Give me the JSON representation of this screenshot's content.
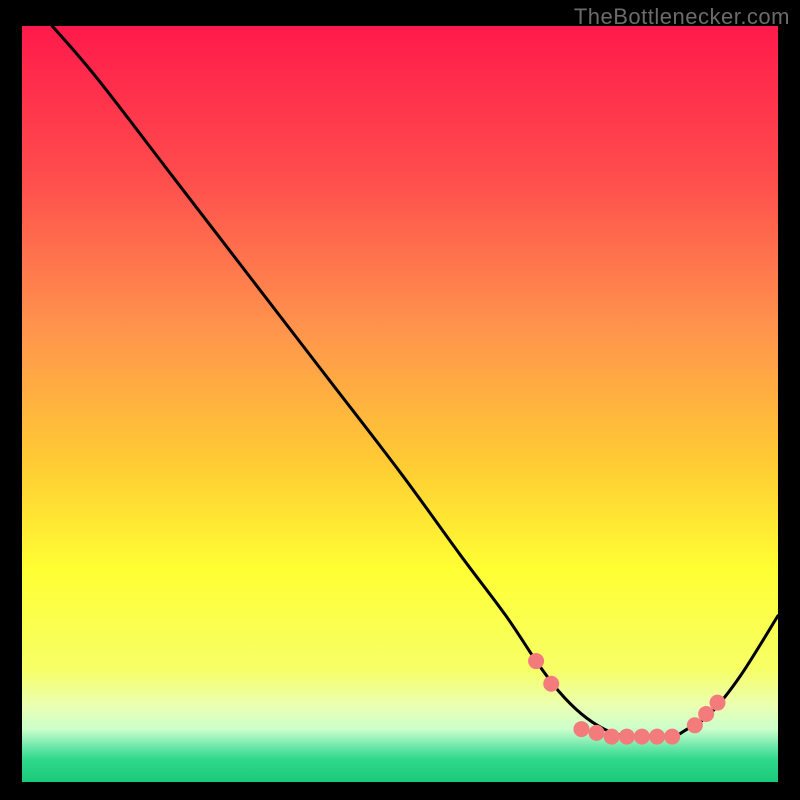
{
  "attribution": "TheBottlenecker.com",
  "chart_data": {
    "type": "line",
    "title": "",
    "xlabel": "",
    "ylabel": "",
    "xlim": [
      0,
      100
    ],
    "ylim": [
      0,
      100
    ],
    "series": [
      {
        "name": "curve",
        "x": [
          4,
          10,
          20,
          30,
          40,
          50,
          58,
          64,
          68,
          71,
          74,
          77,
          80,
          83,
          86,
          88,
          91,
          95,
          100
        ],
        "y": [
          100,
          93,
          80,
          67,
          54,
          41,
          30,
          22,
          16,
          12,
          9,
          7,
          6,
          6,
          6,
          7,
          9,
          14,
          22
        ]
      }
    ],
    "markers": {
      "name": "highlight-dots",
      "x": [
        68,
        70,
        74,
        76,
        78,
        80,
        82,
        84,
        86,
        89,
        90.5,
        92
      ],
      "y": [
        16,
        13,
        7,
        6.5,
        6,
        6,
        6,
        6,
        6,
        7.5,
        9,
        10.5
      ],
      "color": "#f47b7b",
      "radius": 8
    },
    "background": {
      "type": "vertical-gradient",
      "stops": [
        {
          "pos": 0.0,
          "color": "#ff1a4b"
        },
        {
          "pos": 0.2,
          "color": "#ff4d4d"
        },
        {
          "pos": 0.4,
          "color": "#ff944d"
        },
        {
          "pos": 0.58,
          "color": "#ffcc33"
        },
        {
          "pos": 0.72,
          "color": "#ffff33"
        },
        {
          "pos": 0.85,
          "color": "#f7ff66"
        },
        {
          "pos": 0.9,
          "color": "#eaffb3"
        },
        {
          "pos": 0.93,
          "color": "#ccffcc"
        },
        {
          "pos": 0.955,
          "color": "#66e6a6"
        },
        {
          "pos": 0.97,
          "color": "#2fd98a"
        },
        {
          "pos": 1.0,
          "color": "#19c97a"
        }
      ]
    },
    "curve_color": "#000000",
    "curve_width": 3
  }
}
